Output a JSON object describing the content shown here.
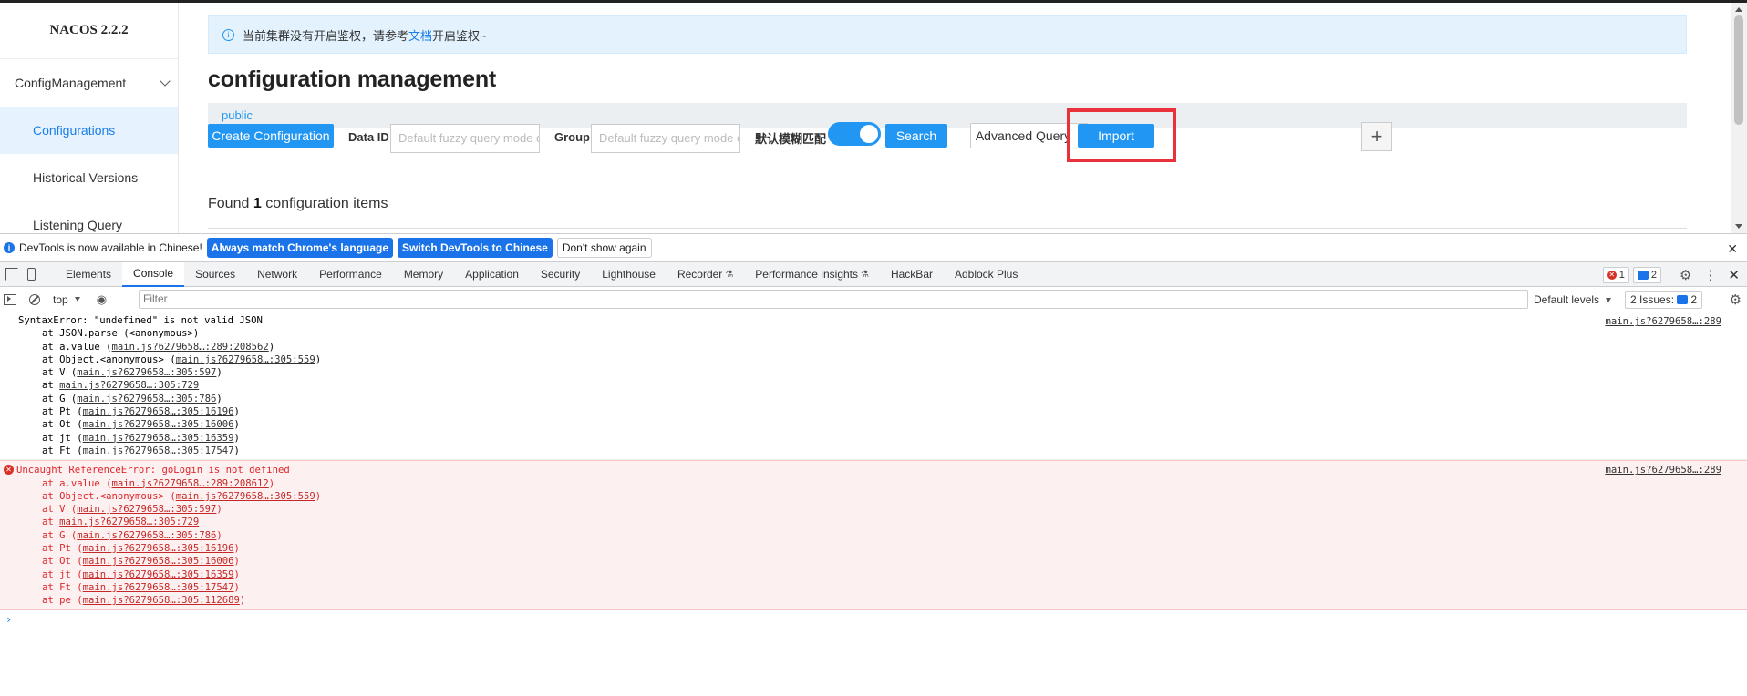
{
  "app": {
    "brand": "NACOS 2.2.2",
    "menu_group": "ConfigManagement",
    "menu_items": [
      "Configurations",
      "Historical Versions",
      "Listening Query"
    ],
    "notice": {
      "before": "当前集群没有开启鉴权，请参考",
      "link": "文档",
      "after": "开启鉴权~"
    },
    "title": "configuration management",
    "namespace": "public",
    "create_button": "Create Configuration",
    "dataid_label": "Data ID",
    "dataid_placeholder": "Default fuzzy query mode ope",
    "group_label": "Group",
    "group_placeholder": "Default fuzzy query mode ope",
    "fuzzy_label": "默认模糊匹配",
    "fuzzy_enabled": true,
    "search_button": "Search",
    "advanced_button": "Advanced Query",
    "import_button": "Import",
    "plus": "+",
    "found_prefix": "Found",
    "found_count": "1",
    "found_suffix": "configuration items",
    "highlight_color": "#e8313b",
    "primary_color": "#2196f3"
  },
  "devtools": {
    "banner_text": "DevTools is now available in Chinese!",
    "banner_btn1": "Always match Chrome's language",
    "banner_btn2": "Switch DevTools to Chinese",
    "banner_btn3": "Don't show again",
    "tabs": [
      "Elements",
      "Console",
      "Sources",
      "Network",
      "Performance",
      "Memory",
      "Application",
      "Security",
      "Lighthouse",
      "Recorder",
      "Performance insights",
      "HackBar",
      "Adblock Plus"
    ],
    "error_count": "1",
    "message_count": "2",
    "context": "top",
    "filter_placeholder": "Filter",
    "levels": "Default levels",
    "issues_label": "2 Issues:",
    "issues_count": "2"
  },
  "console": {
    "msg1": {
      "head": "SyntaxError: \"undefined\" is not valid JSON",
      "source": "main.js?6279658…:289",
      "s1": "at JSON.parse (<anonymous>)",
      "s2p": "at a.value (",
      "s2l": "main.js?6279658…:289:208562",
      "s2s": ")",
      "s3p": "at Object.<anonymous> (",
      "s3l": "main.js?6279658…:305:559",
      "s3s": ")",
      "s4p": "at V (",
      "s4l": "main.js?6279658…:305:597",
      "s4s": ")",
      "s5p": "at ",
      "s5l": "main.js?6279658…:305:729",
      "s6p": "at G (",
      "s6l": "main.js?6279658…:305:786",
      "s6s": ")",
      "s7p": "at Pt (",
      "s7l": "main.js?6279658…:305:16196",
      "s7s": ")",
      "s8p": "at Ot (",
      "s8l": "main.js?6279658…:305:16006",
      "s8s": ")",
      "s9p": "at jt (",
      "s9l": "main.js?6279658…:305:16359",
      "s9s": ")",
      "s10p": "at Ft (",
      "s10l": "main.js?6279658…:305:17547",
      "s10s": ")"
    },
    "msg2": {
      "head": "Uncaught ReferenceError: goLogin is not defined",
      "source": "main.js?6279658…:289",
      "s1p": "at a.value (",
      "s1l": "main.js?6279658…:289:208612",
      "s1s": ")",
      "s2p": "at Object.<anonymous> (",
      "s2l": "main.js?6279658…:305:559",
      "s2s": ")",
      "s3p": "at V (",
      "s3l": "main.js?6279658…:305:597",
      "s3s": ")",
      "s4p": "at ",
      "s4l": "main.js?6279658…:305:729",
      "s5p": "at G (",
      "s5l": "main.js?6279658…:305:786",
      "s5s": ")",
      "s6p": "at Pt (",
      "s6l": "main.js?6279658…:305:16196",
      "s6s": ")",
      "s7p": "at Ot (",
      "s7l": "main.js?6279658…:305:16006",
      "s7s": ")",
      "s8p": "at jt (",
      "s8l": "main.js?6279658…:305:16359",
      "s8s": ")",
      "s9p": "at Ft (",
      "s9l": "main.js?6279658…:305:17547",
      "s9s": ")",
      "s10p": "at pe (",
      "s10l": "main.js?6279658…:305:112689",
      "s10s": ")"
    },
    "prompt": "›"
  }
}
